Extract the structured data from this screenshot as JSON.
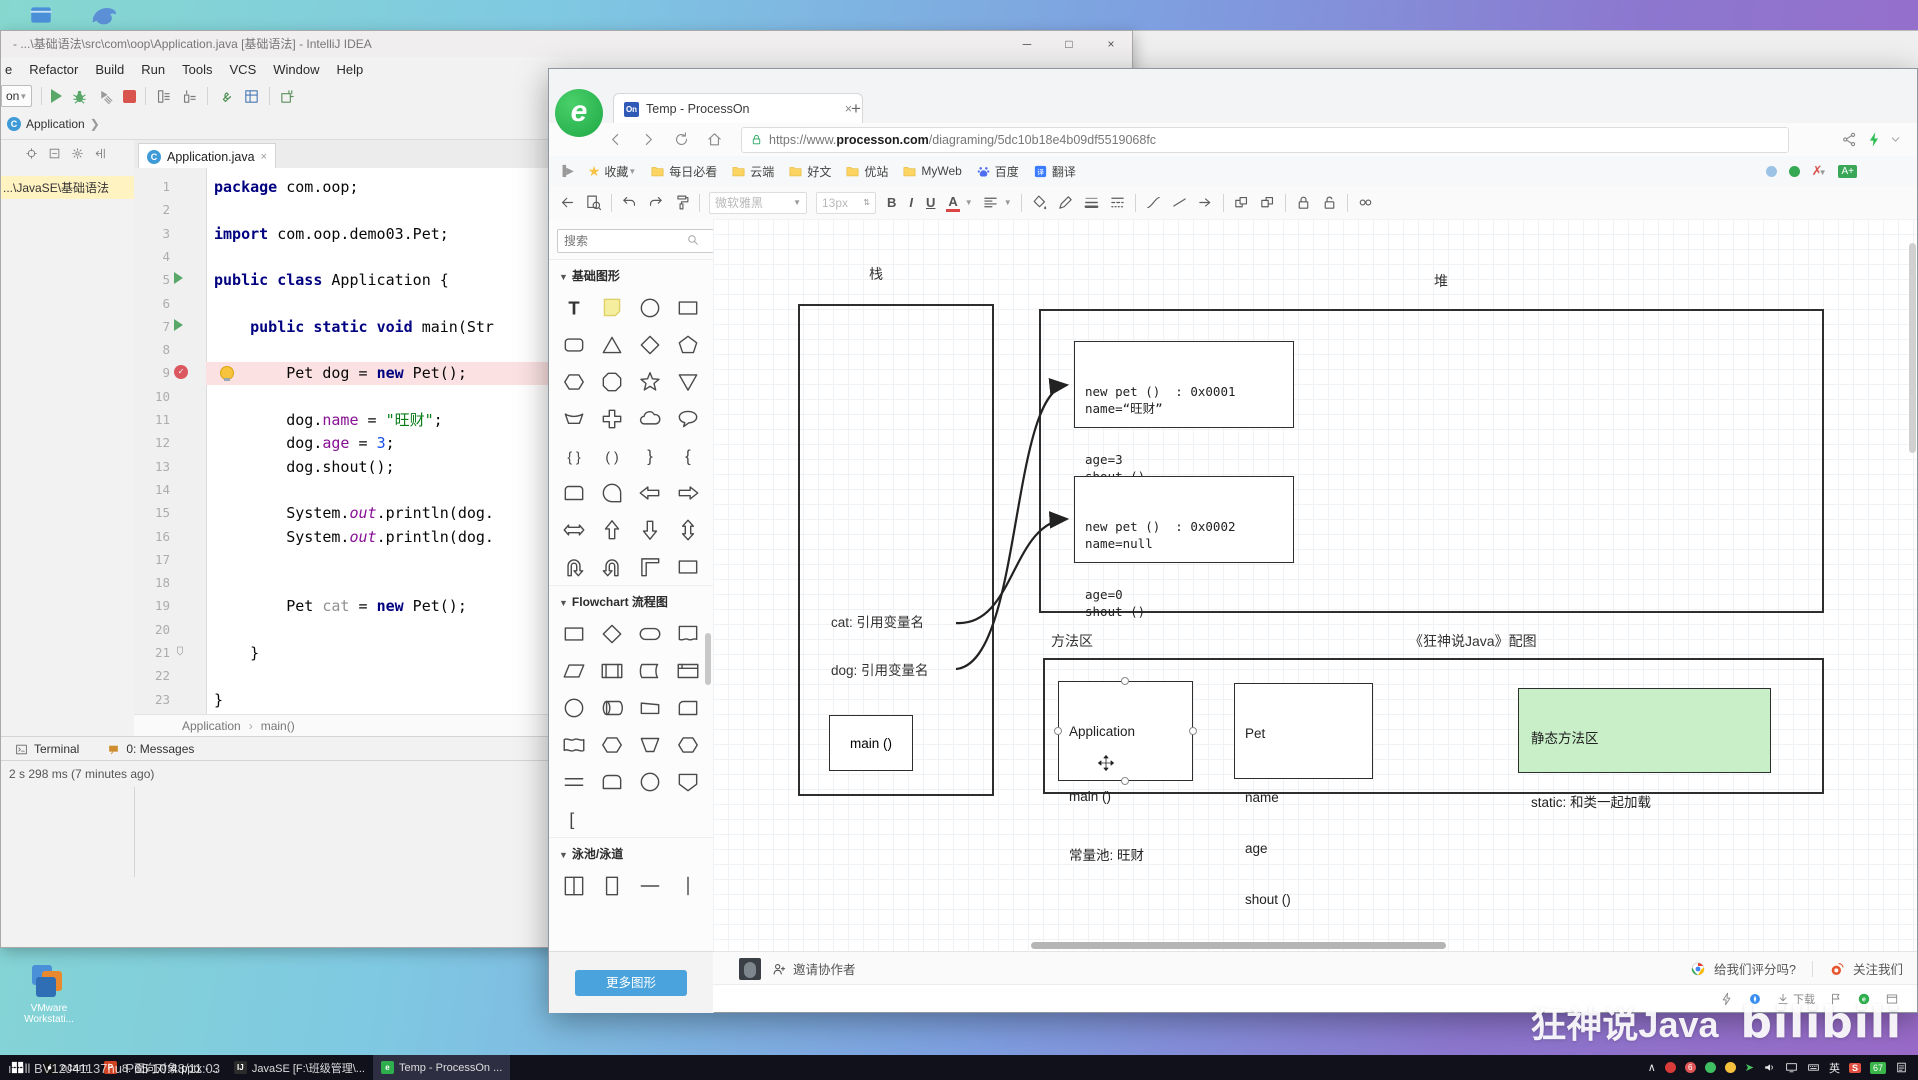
{
  "desktop": {
    "vmware_label": "VMware Workstati...",
    "video_watermark": "ılılıll  BV12J41137hu  P65  10:48/11:03",
    "brand_watermark": "狂神说Java",
    "bili_watermark": "bilibili"
  },
  "ide": {
    "title": "- ...\\基础语法\\src\\com\\oop\\Application.java [基础语法] - IntelliJ IDEA",
    "window_buttons": {
      "minimize": "─",
      "maximize": "□",
      "close": "×"
    },
    "menus": [
      "e",
      "Refactor",
      "Build",
      "Run",
      "Tools",
      "VCS",
      "Window",
      "Help"
    ],
    "run_config": "on",
    "nav_chip": "Application",
    "project_item": "...\\JavaSE\\基础语法",
    "editor_tab": "Application.java",
    "code_lines": [
      [
        [
          "k",
          "package"
        ],
        [
          "p",
          " com.oop;"
        ]
      ],
      [],
      [
        [
          "k",
          "import"
        ],
        [
          "p",
          " com.oop.demo03.Pet;"
        ]
      ],
      [],
      [
        [
          "k",
          "public"
        ],
        [
          "p",
          " "
        ],
        [
          "k",
          "class"
        ],
        [
          "p",
          " Application {"
        ]
      ],
      [],
      [
        [
          "p",
          "    "
        ],
        [
          "k",
          "public"
        ],
        [
          "p",
          " "
        ],
        [
          "k",
          "static"
        ],
        [
          "p",
          " "
        ],
        [
          "k",
          "void"
        ],
        [
          "p",
          " main(Str"
        ]
      ],
      [],
      [
        [
          "p",
          "        Pet dog = "
        ],
        [
          "k",
          "new"
        ],
        [
          "p",
          " Pet();"
        ]
      ],
      [],
      [
        [
          "p",
          "        dog."
        ],
        [
          "f",
          "name"
        ],
        [
          "p",
          " = "
        ],
        [
          "s",
          "\"旺财\""
        ],
        [
          "p",
          ";"
        ]
      ],
      [
        [
          "p",
          "        dog."
        ],
        [
          "f",
          "age"
        ],
        [
          "p",
          " = "
        ],
        [
          "n",
          "3"
        ],
        [
          "p",
          ";"
        ]
      ],
      [
        [
          "p",
          "        dog.shout();"
        ]
      ],
      [],
      [
        [
          "p",
          "        System."
        ],
        [
          "i",
          "out"
        ],
        [
          "p",
          ".println(dog."
        ]
      ],
      [
        [
          "p",
          "        System."
        ],
        [
          "i",
          "out"
        ],
        [
          "p",
          ".println(dog."
        ]
      ],
      [],
      [],
      [
        [
          "p",
          "        Pet "
        ],
        [
          "g",
          "cat"
        ],
        [
          "p",
          " = "
        ],
        [
          "k",
          "new"
        ],
        [
          "p",
          " Pet();"
        ]
      ],
      [],
      [
        [
          "p",
          "    }"
        ]
      ],
      [],
      [
        [
          "p",
          "}"
        ]
      ],
      []
    ],
    "gutter_marks": {
      "5": "run",
      "7": "run",
      "9": "break",
      "21": "fold"
    },
    "breadcrumb": [
      "Application",
      "main()"
    ],
    "tool_windows": [
      "Terminal",
      "0: Messages"
    ],
    "status": "2 s 298 ms (7 minutes ago)"
  },
  "browser": {
    "tab_title": "Temp - ProcessOn",
    "favicon_text": "On",
    "new_tab": "+",
    "close_tab": "×",
    "url_scheme": "https://www.",
    "url_domain": "processon.com",
    "url_path": "/diagraming/5dc10b18e4b09df5519068fc",
    "bookmarks_label": "收藏",
    "bookmarks": [
      "每日必看",
      "云端",
      "好文",
      "优站",
      "MyWeb"
    ],
    "bookmark_baidu": "百度",
    "bookmark_translate": "翻译",
    "format": {
      "font": "微软雅黑",
      "size": "13px",
      "bold": "B",
      "italic": "I",
      "underline": "U",
      "color": "A"
    },
    "shape_panel": {
      "search_placeholder": "搜索",
      "sections": [
        {
          "title": "基础图形",
          "shapes": [
            "text",
            "sticky",
            "circle",
            "rect",
            "roundrect",
            "triangle",
            "diamond",
            "pentagon",
            "hexagon",
            "octagon",
            "star",
            "invtriangle",
            "arctrap",
            "plus",
            "cloud",
            "callout",
            "bracepair",
            "parenpair",
            "rbrace",
            "lbrace",
            "tabshape",
            "teardrop",
            "arrowL",
            "arrowR",
            "arrowLR",
            "arrowU",
            "arrowD",
            "arrowUD",
            "uturn",
            "uturn2",
            "corner",
            "rect"
          ]
        },
        {
          "title": "Flowchart 流程图",
          "shapes": [
            "rect",
            "diamond",
            "stadium",
            "document",
            "para",
            "subprocess",
            "delay",
            "topbar",
            "circle",
            "cylh",
            "trap2",
            "card",
            "tape",
            "hexagon",
            "invtrap",
            "hexagon",
            "dblline",
            "roundtop",
            "circle",
            "shield",
            "bracketL"
          ]
        },
        {
          "title": "泳池/泳道",
          "shapes": [
            "pool2",
            "pool1",
            "hline",
            "vline"
          ]
        }
      ],
      "more_button": "更多图形"
    },
    "footer": {
      "invite": "邀请协作者",
      "rate": "给我们评分吗?",
      "follow": "关注我们",
      "download": "下载"
    }
  },
  "diagram": {
    "stack_label": "栈",
    "heap_label": "堆",
    "method_area_label": "方法区",
    "credit": "《狂神说Java》配图",
    "obj1_lines": [
      "new pet ()  : 0x0001",
      "name=“旺财”",
      "age=3",
      "shout ()"
    ],
    "obj2_lines": [
      "new pet ()  : 0x0002",
      "name=null",
      "age=0",
      "shout ()"
    ],
    "cat_ref": "cat: 引用变量名",
    "dog_ref": "dog: 引用变量名",
    "main_frame": "main ()",
    "app_class": [
      "Application",
      "main ()",
      "常量池: 旺财"
    ],
    "pet_class": [
      "Pet",
      "name",
      "age",
      "shout ()"
    ],
    "static_area": [
      "静态方法区",
      "static: 和类一起加载"
    ],
    "colors": {
      "static_fill": "#c8efc8"
    }
  },
  "taskbar": {
    "items": [
      {
        "label": "ocam",
        "active": false
      },
      {
        "label": "8. 面向对象.pptx - ..",
        "active": false
      },
      {
        "label": "JavaSE [F:\\班级管理\\...",
        "active": false
      },
      {
        "label": "Temp - ProcessOn ...",
        "active": true
      }
    ],
    "tray_lang": "英",
    "tray_sogou": "S",
    "tray_battery": "67"
  }
}
